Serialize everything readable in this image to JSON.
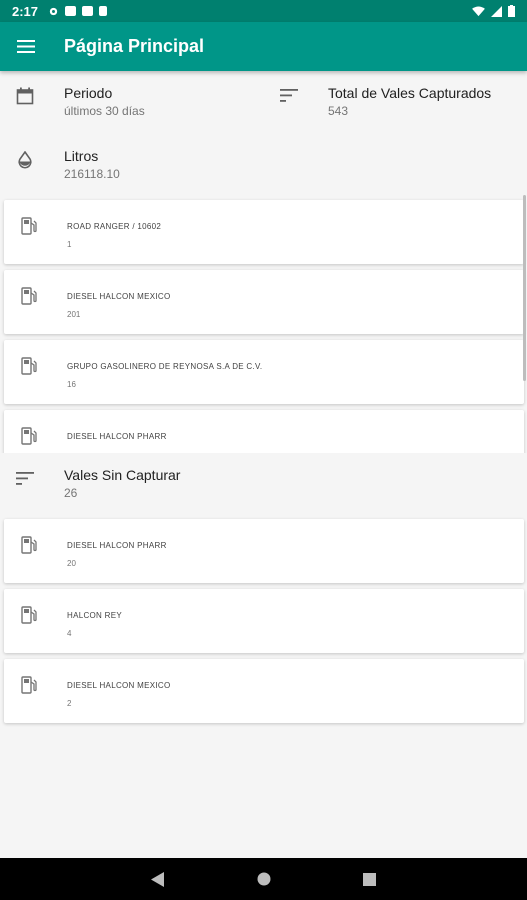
{
  "status_bar": {
    "time": "2:17"
  },
  "app_bar": {
    "title": "Página Principal"
  },
  "summary": {
    "periodo": {
      "label": "Periodo",
      "value": "últimos 30 días"
    },
    "total_vales": {
      "label": "Total de Vales Capturados",
      "value": "543"
    },
    "litros": {
      "label": "Litros",
      "value": "216118.10"
    }
  },
  "captured_list": [
    {
      "name": "ROAD RANGER / 10602",
      "count": "1"
    },
    {
      "name": "DIESEL HALCON MEXICO",
      "count": "201"
    },
    {
      "name": "GRUPO GASOLINERO DE REYNOSA S.A DE C.V.",
      "count": "16"
    },
    {
      "name": "DIESEL HALCON PHARR",
      "count": ""
    }
  ],
  "sin_capturar": {
    "label": "Vales Sin Capturar",
    "value": "26"
  },
  "uncaptured_list": [
    {
      "name": "DIESEL HALCON PHARR",
      "count": "20"
    },
    {
      "name": "HALCON REY",
      "count": "4"
    },
    {
      "name": "DIESEL HALCON MEXICO",
      "count": "2"
    }
  ],
  "colors": {
    "primary": "#009688",
    "status_bar": "#00806f",
    "background": "#f5f5f5"
  }
}
